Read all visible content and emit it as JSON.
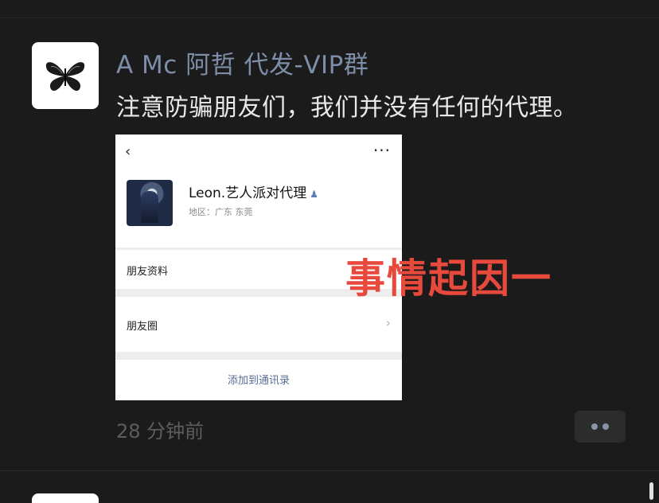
{
  "post": {
    "author": "A Mc 阿哲 代发-VIP群",
    "content": "注意防骗朋友们，我们并没有任何的代理。",
    "time": "28 分钟前",
    "avatar_icon": "butterfly-icon",
    "more_icon": "more-dots-icon"
  },
  "screenshot": {
    "back_icon": "‹",
    "more_icon": "···",
    "profile_name": "Leon.艺人派对代理",
    "region": "地区：广东  东莞",
    "rows": [
      {
        "label": "朋友资料"
      },
      {
        "label": "朋友圈"
      }
    ],
    "add_button": "添加到通讯录"
  },
  "overlay_text": "事情起因一",
  "colors": {
    "background": "#1b1b1b",
    "author_name": "#7e8da8",
    "overlay_red": "#e8493d",
    "link_blue": "#576b95"
  }
}
